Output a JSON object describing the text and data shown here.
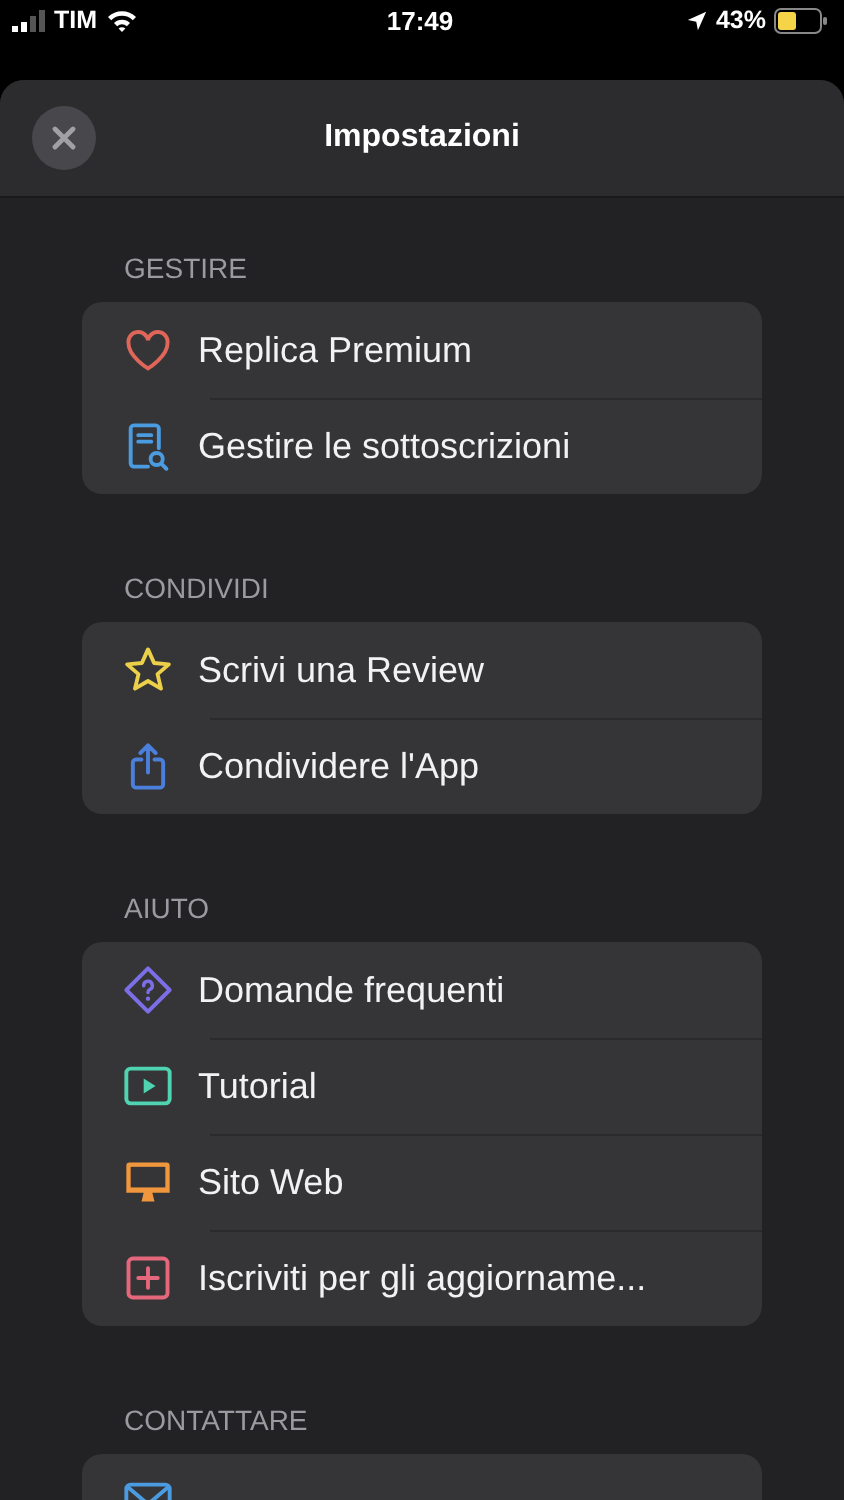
{
  "status_bar": {
    "carrier": "TIM",
    "time": "17:49",
    "battery": "43%"
  },
  "header": {
    "title": "Impostazioni"
  },
  "sections": [
    {
      "title": "GESTIRE",
      "items": [
        {
          "kind": "heart",
          "label": "Replica Premium",
          "color": "#e0665a"
        },
        {
          "kind": "document",
          "label": "Gestire le sottoscrizioni",
          "color": "#4a9be0"
        }
      ]
    },
    {
      "title": "CONDIVIDI",
      "items": [
        {
          "kind": "star",
          "label": "Scrivi una Review",
          "color": "#ecd04a"
        },
        {
          "kind": "share",
          "label": "Condividere l'App",
          "color": "#4a80dc"
        }
      ]
    },
    {
      "title": "AIUTO",
      "items": [
        {
          "kind": "question",
          "label": "Domande frequenti",
          "color": "#7b6ee6"
        },
        {
          "kind": "play",
          "label": "Tutorial",
          "color": "#4fd3b0"
        },
        {
          "kind": "monitor",
          "label": "Sito Web",
          "color": "#f0973e"
        },
        {
          "kind": "plus",
          "label": "Iscriviti per gli aggiorname...",
          "color": "#e5677c"
        }
      ]
    },
    {
      "title": "CONTATTARE",
      "items": [
        {
          "kind": "mail",
          "color": "#4a9be0"
        }
      ]
    }
  ]
}
